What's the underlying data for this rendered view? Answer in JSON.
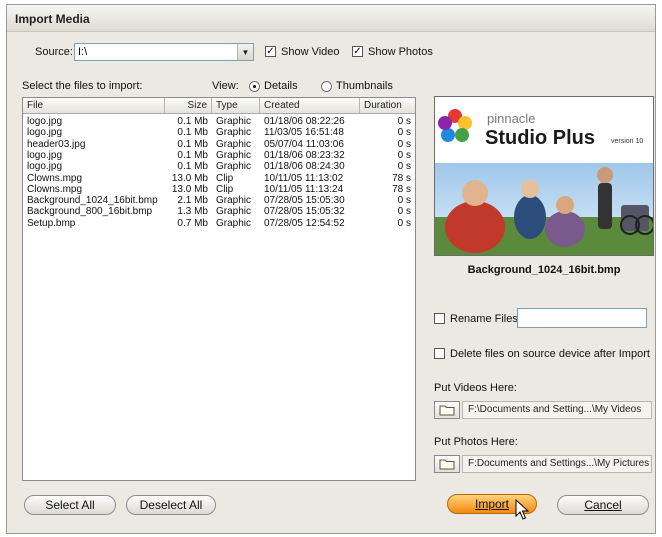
{
  "window": {
    "title": "Import Media"
  },
  "source": {
    "label": "Source:",
    "value": "I:\\"
  },
  "options": {
    "show_video": "Show Video",
    "show_photos": "Show Photos"
  },
  "select_label": "Select the files to import:",
  "view": {
    "label": "View:",
    "details": "Details",
    "thumbnails": "Thumbnails",
    "selected": "Details"
  },
  "filelist": {
    "columns": [
      "File",
      "Size",
      "Type",
      "Created",
      "Duration"
    ],
    "rows": [
      {
        "file": "logo.jpg",
        "size": "0.1 Mb",
        "type": "Graphic",
        "created": "01/18/06 08:22:26",
        "duration": "0 s"
      },
      {
        "file": "logo.jpg",
        "size": "0.1 Mb",
        "type": "Graphic",
        "created": "11/03/05 16:51:48",
        "duration": "0 s"
      },
      {
        "file": "header03.jpg",
        "size": "0.1 Mb",
        "type": "Graphic",
        "created": "05/07/04 11:03:06",
        "duration": "0 s"
      },
      {
        "file": "logo.jpg",
        "size": "0.1 Mb",
        "type": "Graphic",
        "created": "01/18/06 08:23:32",
        "duration": "0 s"
      },
      {
        "file": "logo.jpg",
        "size": "0.1 Mb",
        "type": "Graphic",
        "created": "01/18/06 08:24:30",
        "duration": "0 s"
      },
      {
        "file": "Clowns.mpg",
        "size": "13.0 Mb",
        "type": "Clip",
        "created": "10/11/05 11:13:02",
        "duration": "78 s"
      },
      {
        "file": "Clowns.mpg",
        "size": "13.0 Mb",
        "type": "Clip",
        "created": "10/11/05 11:13:24",
        "duration": "78 s"
      },
      {
        "file": "Background_1024_16bit.bmp",
        "size": "2.1 Mb",
        "type": "Graphic",
        "created": "07/28/05 15:05:30",
        "duration": "0 s"
      },
      {
        "file": "Background_800_16bit.bmp",
        "size": "1.3 Mb",
        "type": "Graphic",
        "created": "07/28/05 15:05:32",
        "duration": "0 s"
      },
      {
        "file": "Setup.bmp",
        "size": "0.7 Mb",
        "type": "Graphic",
        "created": "07/28/05 12:54:52",
        "duration": "0 s"
      }
    ]
  },
  "preview": {
    "brand": "pinnacle",
    "product": "Studio Plus",
    "version": "version 10",
    "filename": "Background_1024_16bit.bmp"
  },
  "rename": {
    "label": "Rename Files",
    "value": ""
  },
  "delete_label": "Delete files on source device after Import",
  "videos": {
    "label": "Put Videos Here:",
    "path": "F:\\Documents and Setting...\\My Videos"
  },
  "photos": {
    "label": "Put Photos Here:",
    "path": "F:Documents and Settings...\\My Pictures"
  },
  "buttons": {
    "select_all": "Select All",
    "deselect_all": "Deselect All",
    "import": "Import",
    "cancel": "Cancel"
  },
  "colors": {
    "accent": "#f58a12",
    "window_bg": "#ece9e2"
  }
}
